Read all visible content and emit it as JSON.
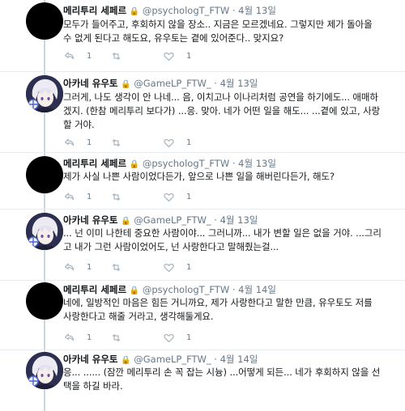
{
  "tweets": [
    {
      "name": "메리투리 세페르",
      "lock": "🔒",
      "handle": "@psychologT_FTW",
      "dot": "·",
      "time": "4월 13일",
      "lines": [
        "모두가 들어주고, 후회하지 않을 장소.. 지금은 모르겠네요. 그렇지만 제가 돌아올",
        "수 없게 된다고 해도요, 유우토는 곁에 있어준다.. 맞지요?"
      ],
      "reply_count": "1",
      "retweet_count": "",
      "like_count": "1",
      "avatar": "black"
    },
    {
      "name": "아카네 유우토",
      "lock": "🔒",
      "handle": "@GameLP_FTW_",
      "dot": "·",
      "time": "4월 13일",
      "lines": [
        "그러게, 나도 생각이 안 나네... 음, 이치고나 이나리처럼 공연을 하기에도... 애매하",
        "겠지. (한참 메리투리 보다가) ...응. 맞아. 네가 어떤 일을 해도... ...곁에 있고, 사랑",
        "할 거야."
      ],
      "reply_count": "1",
      "retweet_count": "",
      "like_count": "1",
      "avatar": "anime"
    },
    {
      "name": "메리투리 세페르",
      "lock": "🔒",
      "handle": "@psychologT_FTW",
      "dot": "·",
      "time": "4월 13일",
      "lines": [
        "제가 사실 나쁜 사람이었다든가, 앞으로 나쁜 일을 해버린다든가, 해도?"
      ],
      "reply_count": "1",
      "retweet_count": "",
      "like_count": "1",
      "avatar": "black"
    },
    {
      "name": "아카네 유우토",
      "lock": "🔒",
      "handle": "@GameLP_FTW_",
      "dot": "·",
      "time": "4월 13일",
      "lines": [
        "... 넌 이미 나한테 중요한 사람이야... 그러니까... 내가 변할 일은 없을 거야. ...그리",
        "고 내가 그런 사람이었어도, 넌 사랑한다고 말해줬는걸..."
      ],
      "reply_count": "1",
      "retweet_count": "",
      "like_count": "1",
      "avatar": "anime"
    },
    {
      "name": "메리투리 세페르",
      "lock": "🔒",
      "handle": "@psychologT_FTW",
      "dot": "·",
      "time": "4월 14일",
      "lines": [
        "네에, 일방적인 마음은 힘든 거니까요, 제가 사랑한다고 말한 만큼, 유우토도 저를",
        "사랑한다고 해줄 거라고, 생각해둘게요."
      ],
      "reply_count": "1",
      "retweet_count": "",
      "like_count": "1",
      "avatar": "black"
    },
    {
      "name": "아카네 유우토",
      "lock": "🔒",
      "handle": "@GameLP_FTW_",
      "dot": "·",
      "time": "4월 14일",
      "lines": [
        "응... ...... (잠깐 메리투리 손 꼭 잡는 시늉) ...어떻게 되든... 네가 후회하지 않을 선",
        "택을 하길 바라."
      ],
      "reply_count": "",
      "retweet_count": "",
      "like_count": "",
      "avatar": "anime"
    }
  ]
}
